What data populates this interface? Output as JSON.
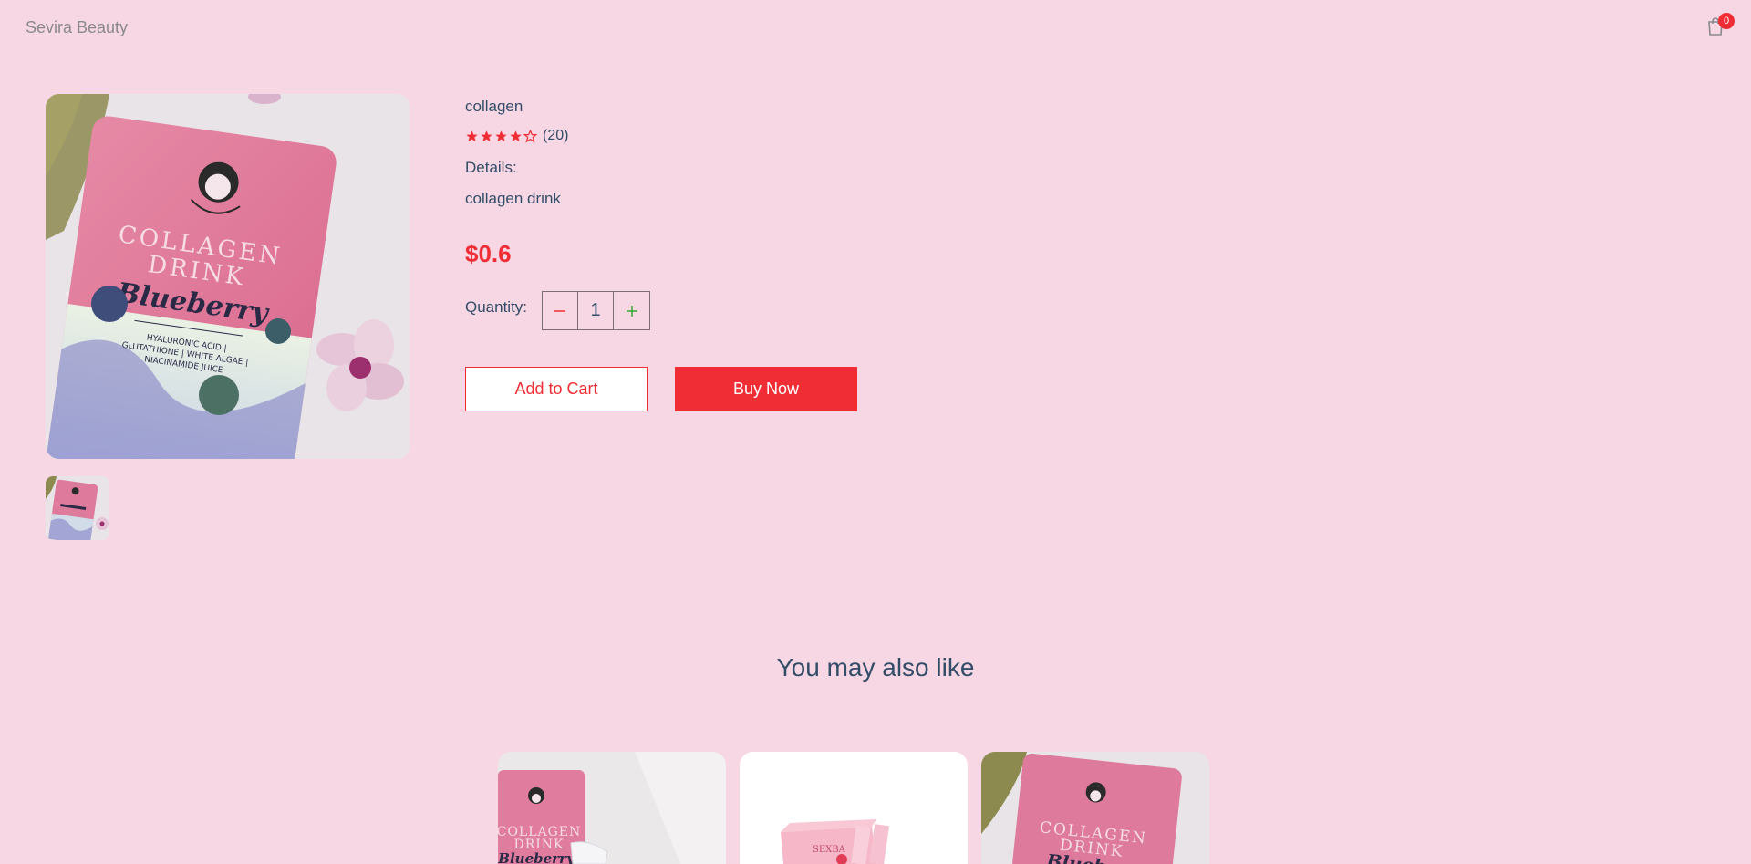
{
  "navbar": {
    "logo": "Sevira Beauty",
    "cart_count": "0",
    "cart_icon": "shopping-bag-icon"
  },
  "product": {
    "name": "collagen",
    "rating": 4,
    "rating_max": 5,
    "review_count": "(20)",
    "details_label": "Details:",
    "details_text": "collagen drink",
    "price": "$0.6",
    "quantity_label": "Quantity:",
    "quantity_value": "1",
    "image_caption": {
      "top": "COLLAGEN",
      "middle": "DRINK",
      "flavor": "Blueberry",
      "ingredients_1": "HYALURONIC ACID |",
      "ingredients_2": "GLUTATHIONE | WHITE ALGAE |",
      "ingredients_3": "NIACINAMIDE JUICE"
    },
    "add_to_cart_label": "Add to Cart",
    "buy_now_label": "Buy Now"
  },
  "recommendations": {
    "title": "You may also like",
    "items": [
      {
        "image": "collagen-drink-blueberry-with-glass",
        "caption_top": "COLLAGEN",
        "caption_mid": "DRINK",
        "caption_flavor": "Blueberry"
      },
      {
        "image": "pink-product-box",
        "caption_top": "SEXBA"
      },
      {
        "image": "collagen-drink-blueberry-on-table",
        "caption_top": "COLLAGEN",
        "caption_mid": "DRINK",
        "caption_flavor": "Blueb"
      }
    ]
  },
  "colors": {
    "background": "#f8d7e4",
    "accent": "#f02d34",
    "text": "#324d67",
    "plus": "#31a831"
  }
}
